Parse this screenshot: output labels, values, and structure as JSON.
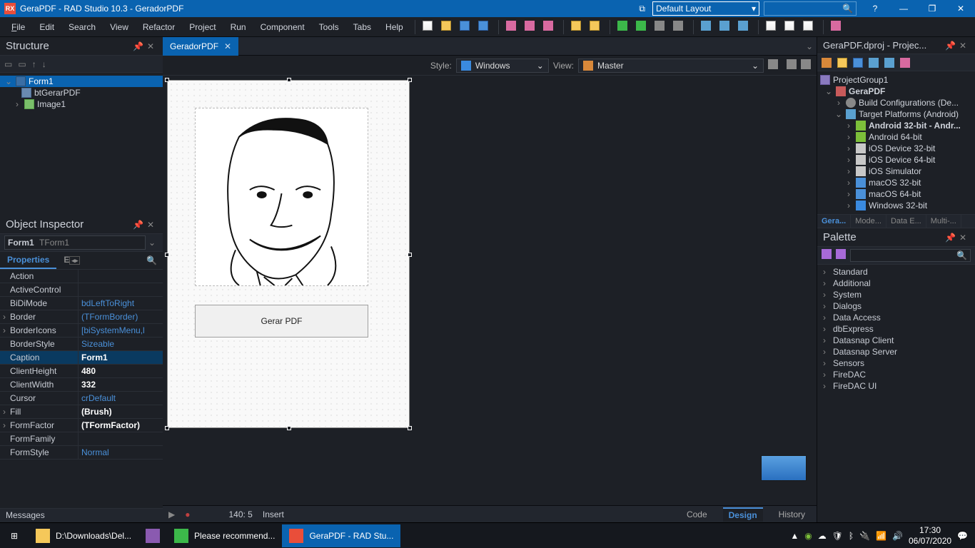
{
  "title": "GeraPDF - RAD Studio 10.3 - GeradorPDF",
  "layout_selector": "Default Layout",
  "menu": {
    "file": "File",
    "edit": "Edit",
    "search": "Search",
    "view": "View",
    "refactor": "Refactor",
    "project": "Project",
    "run": "Run",
    "component": "Component",
    "tools": "Tools",
    "tabs": "Tabs",
    "help": "Help"
  },
  "structure": {
    "title": "Structure",
    "root": "Form1",
    "children": [
      {
        "name": "btGerarPDF",
        "icon": "btn"
      },
      {
        "name": "Image1",
        "icon": "img",
        "expandable": true
      }
    ]
  },
  "object_inspector": {
    "title": "Object Inspector",
    "selection": "Form1",
    "selection_type": "TForm1",
    "tabs": {
      "properties": "Properties",
      "events": "Events"
    },
    "props": [
      {
        "name": "Action",
        "val": "",
        "link": false
      },
      {
        "name": "ActiveControl",
        "val": "",
        "link": false
      },
      {
        "name": "BiDiMode",
        "val": "bdLeftToRight",
        "link": true
      },
      {
        "name": "Border",
        "val": "(TFormBorder)",
        "link": true,
        "child": true
      },
      {
        "name": "BorderIcons",
        "val": "[biSystemMenu,l",
        "link": true,
        "child": true
      },
      {
        "name": "BorderStyle",
        "val": "Sizeable",
        "link": true
      },
      {
        "name": "Caption",
        "val": "Form1",
        "sel": true
      },
      {
        "name": "ClientHeight",
        "val": "480",
        "bold": true
      },
      {
        "name": "ClientWidth",
        "val": "332",
        "bold": true
      },
      {
        "name": "Cursor",
        "val": "crDefault",
        "link": true
      },
      {
        "name": "Fill",
        "val": "(Brush)",
        "bold": true,
        "child": true
      },
      {
        "name": "FormFactor",
        "val": "(TFormFactor)",
        "bold": true,
        "child": true
      },
      {
        "name": "FormFamily",
        "val": ""
      },
      {
        "name": "FormStyle",
        "val": "Normal",
        "link": true
      }
    ]
  },
  "messages_label": "Messages",
  "editor": {
    "filetab": "GeradorPDF",
    "style_label": "Style:",
    "style_value": "Windows",
    "view_label": "View:",
    "view_value": "Master",
    "button_caption": "Gerar PDF",
    "status_pos": "140:   5",
    "status_mode": "Insert",
    "tabs": {
      "code": "Code",
      "design": "Design",
      "history": "History"
    }
  },
  "project": {
    "title": "GeraPDF.dproj - Projec...",
    "group": "ProjectGroup1",
    "name": "GeraPDF",
    "build_conf": "Build Configurations (De...",
    "target_platforms": "Target Platforms (Android)",
    "platforms": [
      {
        "name": "Android 32-bit - Andr...",
        "icon": "android",
        "bold": true
      },
      {
        "name": "Android 64-bit",
        "icon": "android"
      },
      {
        "name": "iOS Device 32-bit",
        "icon": "ios"
      },
      {
        "name": "iOS Device 64-bit",
        "icon": "ios"
      },
      {
        "name": "iOS Simulator",
        "icon": "ios"
      },
      {
        "name": "macOS 32-bit",
        "icon": "mac"
      },
      {
        "name": "macOS 64-bit",
        "icon": "mac"
      },
      {
        "name": "Windows 32-bit",
        "icon": "win"
      }
    ],
    "tabs": [
      "Gera...",
      "Mode...",
      "Data E...",
      "Multi-..."
    ]
  },
  "palette": {
    "title": "Palette",
    "categories": [
      "Standard",
      "Additional",
      "System",
      "Dialogs",
      "Data Access",
      "dbExpress",
      "Datasnap Client",
      "Datasnap Server",
      "Sensors",
      "FireDAC",
      "FireDAC UI"
    ]
  },
  "taskbar": {
    "items": [
      {
        "label": "D:\\Downloads\\Del...",
        "icon": "folder"
      },
      {
        "label": "",
        "icon": "winrar"
      },
      {
        "label": "Please recommend...",
        "icon": "chrome"
      },
      {
        "label": "GeraPDF - RAD Stu...",
        "icon": "rad",
        "active": true
      }
    ],
    "time": "17:30",
    "date": "06/07/2020"
  }
}
